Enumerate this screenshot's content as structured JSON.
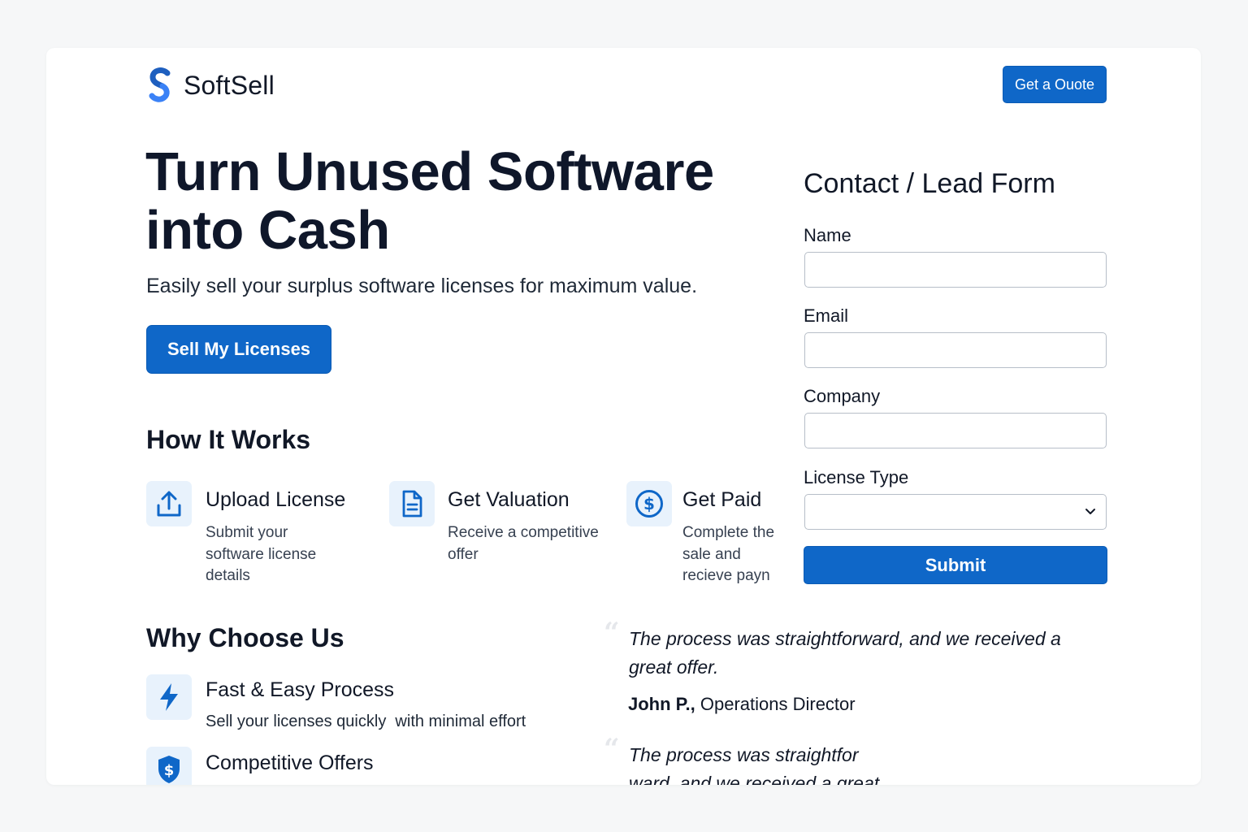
{
  "header": {
    "brand": "SoftSell",
    "quote_button": "Get a Ouote"
  },
  "hero": {
    "title": "Turn Unused Software into Cash",
    "subtitle": "Easily sell your surplus software licenses for maximum value.",
    "cta": "Sell My Licenses"
  },
  "how_it_works": {
    "title": "How It Works",
    "steps": [
      {
        "icon": "upload-icon",
        "title": "Upload License",
        "desc": "Submit your software license details"
      },
      {
        "icon": "document-icon",
        "title": "Get Valuation",
        "desc": "Receive a competitive offer"
      },
      {
        "icon": "dollar-icon",
        "title": "Get Paid",
        "desc": "Complete the sale and recieve payn"
      }
    ]
  },
  "form": {
    "title": "Contact / Lead Form",
    "fields": [
      {
        "label": "Name",
        "value": "",
        "placeholder": ""
      },
      {
        "label": "Email",
        "value": "",
        "placeholder": ""
      },
      {
        "label": "Company",
        "value": "",
        "placeholder": ""
      }
    ],
    "license_type": {
      "label": "License Type",
      "selected": ""
    },
    "submit": "Submit"
  },
  "why_choose_us": {
    "title": "Why Choose Us",
    "features": [
      {
        "icon": "lightning-icon",
        "title": "Fast & Easy Process",
        "desc": "Sell your licenses quickly  with minimal effort"
      },
      {
        "icon": "dollar-shield-icon",
        "title": "Competitive Offers",
        "desc": ""
      }
    ]
  },
  "testimonials": [
    {
      "quote": "The process was straightforward, and we received a great offer.",
      "author": "John P.,",
      "role": "Operations Director"
    },
    {
      "quote": "The process was straightfor ward. and we received a great offer",
      "author": "",
      "role": ""
    }
  ],
  "colors": {
    "accent": "#0f67c8",
    "icon_bg": "#e8f2fc",
    "page_bg": "#f6f7f8",
    "card_bg": "#ffffff"
  }
}
